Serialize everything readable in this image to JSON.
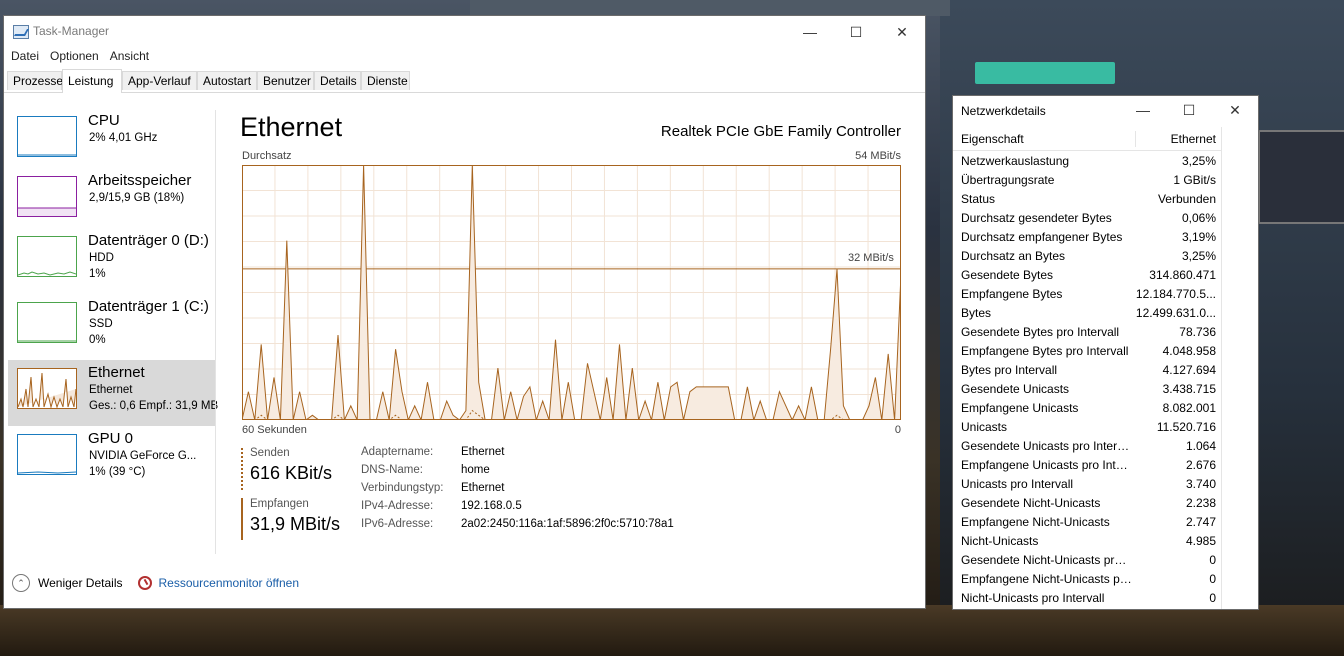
{
  "window": {
    "title": "Task-Manager",
    "controls": {
      "minimize": "—",
      "maximize": "☐",
      "close": "✕"
    }
  },
  "menu": [
    "Datei",
    "Optionen",
    "Ansicht"
  ],
  "tabs": [
    "Prozesse",
    "Leistung",
    "App-Verlauf",
    "Autostart",
    "Benutzer",
    "Details",
    "Dienste"
  ],
  "active_tab": "Leistung",
  "devices": [
    {
      "name": "CPU",
      "line1": "2% 4,01 GHz",
      "line2": "",
      "color": "#1a7bbf"
    },
    {
      "name": "Arbeitsspeicher",
      "line1": "2,9/15,9 GB (18%)",
      "line2": "",
      "color": "#8b1fa0"
    },
    {
      "name": "Datenträger 0 (D:)",
      "line1": "HDD",
      "line2": "1%",
      "color": "#4ca44c"
    },
    {
      "name": "Datenträger 1 (C:)",
      "line1": "SSD",
      "line2": "0%",
      "color": "#4ca44c"
    },
    {
      "name": "Ethernet",
      "line1": "Ethernet",
      "line2": "Ges.: 0,6 Empf.: 31,9 MB",
      "color": "#a7641f"
    },
    {
      "name": "GPU 0",
      "line1": "NVIDIA GeForce G...",
      "line2": "1% (39 °C)",
      "color": "#1a7bbf"
    }
  ],
  "main": {
    "title": "Ethernet",
    "adapter": "Realtek PCIe GbE Family Controller",
    "graph_label": "Durchsatz",
    "graph_max": "54 MBit/s",
    "graph_mid": "32 MBit/s",
    "graph_left": "60 Sekunden",
    "graph_right": "0"
  },
  "stats": {
    "send_label": "Senden",
    "send_value": "616 KBit/s",
    "recv_label": "Empfangen",
    "recv_value": "31,9 MBit/s"
  },
  "details": [
    {
      "k": "Adaptername:",
      "v": "Ethernet"
    },
    {
      "k": "DNS-Name:",
      "v": "home"
    },
    {
      "k": "Verbindungstyp:",
      "v": "Ethernet"
    },
    {
      "k": "IPv4-Adresse:",
      "v": "192.168.0.5"
    },
    {
      "k": "IPv6-Adresse:",
      "v": "2a02:2450:116a:1af:5896:2f0c:5710:78a1"
    }
  ],
  "footer": {
    "less": "Weniger Details",
    "resmon": "Ressourcenmonitor öffnen"
  },
  "netdetails": {
    "title": "Netzwerkdetails",
    "col_prop": "Eigenschaft",
    "col_val": "Ethernet",
    "rows": [
      [
        "Netzwerkauslastung",
        "3,25%"
      ],
      [
        "Übertragungsrate",
        "1 GBit/s"
      ],
      [
        "Status",
        "Verbunden"
      ],
      [
        "Durchsatz gesendeter Bytes",
        "0,06%"
      ],
      [
        "Durchsatz empfangener Bytes",
        "3,19%"
      ],
      [
        "Durchsatz an Bytes",
        "3,25%"
      ],
      [
        "Gesendete Bytes",
        "314.860.471"
      ],
      [
        "Empfangene Bytes",
        "12.184.770.5..."
      ],
      [
        "Bytes",
        "12.499.631.0..."
      ],
      [
        "Gesendete Bytes pro Intervall",
        "78.736"
      ],
      [
        "Empfangene Bytes pro Intervall",
        "4.048.958"
      ],
      [
        "Bytes pro Intervall",
        "4.127.694"
      ],
      [
        "Gesendete Unicasts",
        "3.438.715"
      ],
      [
        "Empfangene Unicasts",
        "8.082.001"
      ],
      [
        "Unicasts",
        "11.520.716"
      ],
      [
        "Gesendete Unicasts pro Intervall",
        "1.064"
      ],
      [
        "Empfangene Unicasts pro Inter...",
        "2.676"
      ],
      [
        "Unicasts pro Intervall",
        "3.740"
      ],
      [
        "Gesendete Nicht-Unicasts",
        "2.238"
      ],
      [
        "Empfangene Nicht-Unicasts",
        "2.747"
      ],
      [
        "Nicht-Unicasts",
        "4.985"
      ],
      [
        "Gesendete Nicht-Unicasts pro I...",
        "0"
      ],
      [
        "Empfangene Nicht-Unicasts pr...",
        "0"
      ],
      [
        "Nicht-Unicasts pro Intervall",
        "0"
      ]
    ]
  },
  "chart_data": {
    "type": "area",
    "ylim": [
      0,
      54
    ],
    "series": [
      {
        "values": [
          0,
          6,
          0,
          16,
          0,
          9,
          0,
          38,
          0,
          6,
          0,
          1,
          0,
          0,
          0,
          18,
          0,
          3,
          0,
          54,
          0,
          0,
          6,
          0,
          15,
          6,
          0,
          3,
          0,
          8,
          0,
          0,
          4,
          1,
          0,
          2,
          54,
          8,
          0,
          0,
          11,
          0,
          6,
          0,
          5,
          7,
          0,
          4,
          0,
          17,
          0,
          8,
          0,
          0,
          12,
          6,
          0,
          9,
          0,
          16,
          0,
          11,
          0,
          4,
          0,
          8,
          0,
          7,
          8,
          0,
          6,
          7,
          7,
          7,
          7,
          7,
          7,
          0,
          0,
          7,
          0,
          4,
          0,
          0,
          6,
          3,
          0,
          3,
          0,
          7,
          0,
          0,
          15,
          32,
          3,
          0,
          0,
          0,
          3,
          9,
          0,
          14,
          0,
          31
        ]
      },
      {
        "values": [
          0,
          0,
          0,
          1,
          0,
          0,
          0,
          0,
          0,
          0,
          0,
          0,
          0,
          0,
          0,
          1,
          0,
          0,
          0,
          0,
          0,
          0,
          0,
          0,
          1,
          0,
          0,
          0,
          0,
          0,
          0,
          0,
          0,
          0,
          0,
          0,
          2,
          1,
          0,
          0,
          0,
          0,
          0,
          0,
          0,
          0,
          0,
          0,
          0,
          0,
          0,
          0,
          0,
          0,
          0,
          0,
          0,
          0,
          0,
          0,
          0,
          0,
          0,
          0,
          0,
          0,
          0,
          0,
          0,
          0,
          0,
          0,
          0,
          0,
          0,
          0,
          0,
          0,
          0,
          0,
          0,
          0,
          0,
          0,
          0,
          0,
          0,
          0,
          0,
          0,
          0,
          0,
          0,
          1,
          0,
          0,
          0,
          0,
          0,
          0,
          0,
          0,
          0,
          0
        ]
      }
    ],
    "grid": true,
    "accent": "#a7641f"
  }
}
